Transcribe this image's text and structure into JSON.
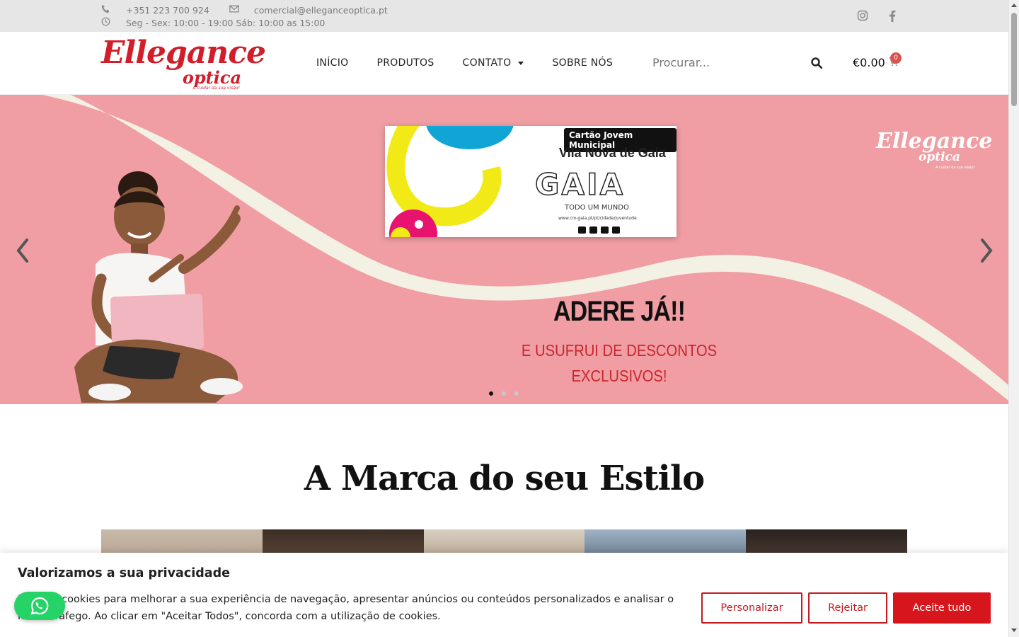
{
  "topbar": {
    "phone": "+351 223 700 924",
    "email": "comercial@elleganceoptica.pt",
    "hours": "Seg - Sex: 10:00 - 19:00 Sáb: 10:00 as 15:00"
  },
  "header": {
    "logo_main": "Ellegance",
    "logo_sub": "optica",
    "logo_tagline": "A cuidar da sua visão!",
    "nav": [
      "INÍCIO",
      "PRODUTOS",
      "CONTATO",
      "SOBRE NÓS"
    ],
    "search_placeholder": "Procurar...",
    "cart_total": "€0.00",
    "cart_count": "0"
  },
  "hero": {
    "card_tag": "Cartão Jovem Municipal",
    "card_city": "Vila Nova de Gaia",
    "card_brand": "GAIA",
    "card_slogan": "TODO UM MUNDO",
    "card_url": "www.cm-gaia.pt/pt/cidade/juventude",
    "brand_main": "Ellegance",
    "brand_sub": "optica",
    "brand_tagline": "A cuidar da sua visão!",
    "headline": "ADERE JÁ!!",
    "subline_1": "E USUFRUI DE DESCONTOS",
    "subline_2": "EXCLUSIVOS!",
    "slides_total": 3,
    "active_slide": 1
  },
  "section": {
    "title": "A Marca do seu Estilo"
  },
  "cookie": {
    "title": "Valorizamos a sua privacidade",
    "text": "Usamos cookies para melhorar a sua experiência de navegação, apresentar anúncios ou conteúdos personalizados e analisar o nosso tráfego. Ao clicar em \"Aceitar Todos\", concorda com a utilização de cookies.",
    "customize": "Personalizar",
    "reject": "Rejeitar",
    "accept": "Aceite tudo"
  },
  "colors": {
    "brand_red": "#d21e2b",
    "hero_pink": "#f09ea3",
    "accept_red": "#d7151c",
    "whatsapp_green": "#25d366"
  },
  "icons": [
    "phone-icon",
    "envelope-icon",
    "clock-icon",
    "instagram-icon",
    "facebook-icon",
    "search-icon",
    "cart-icon",
    "chevron-left-icon",
    "chevron-right-icon",
    "whatsapp-icon"
  ]
}
